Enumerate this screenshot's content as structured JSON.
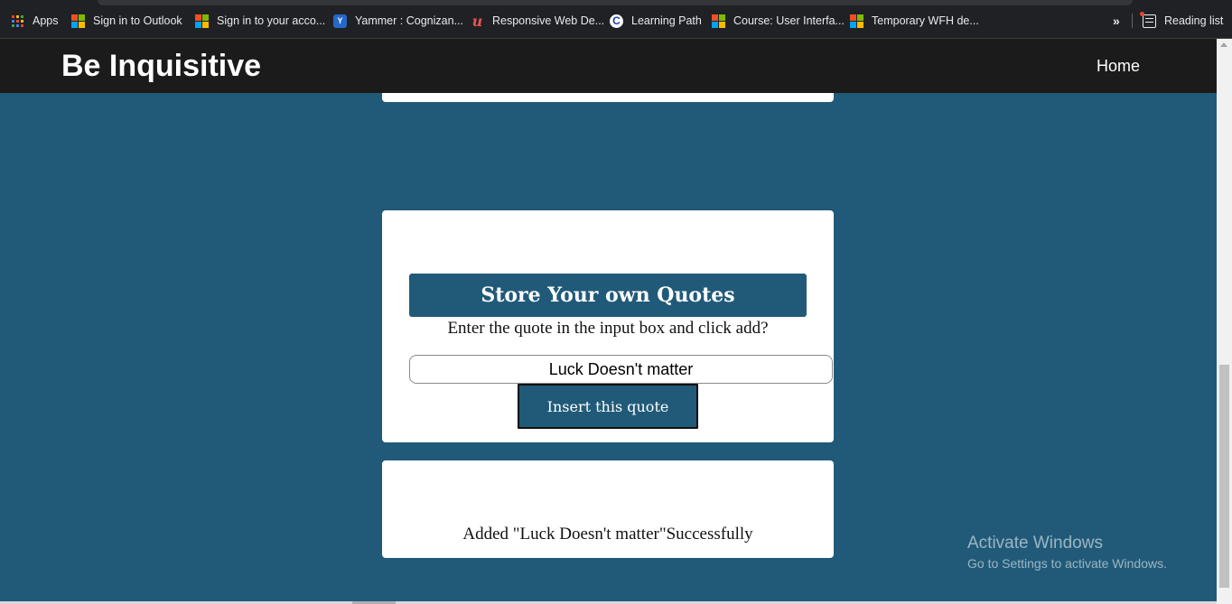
{
  "bookmarks": {
    "items": [
      {
        "label": "Apps",
        "icon": "apps-grid-icon"
      },
      {
        "label": "Sign in to Outlook",
        "icon": "microsoft-logo-icon"
      },
      {
        "label": "Sign in to your acco...",
        "icon": "microsoft-logo-icon"
      },
      {
        "label": "Yammer : Cognizan...",
        "icon": "yammer-icon"
      },
      {
        "label": "Responsive Web De...",
        "icon": "udemy-icon"
      },
      {
        "label": "Learning Path",
        "icon": "c-logo-icon"
      },
      {
        "label": "Course: User Interfa...",
        "icon": "microsoft-logo-icon"
      },
      {
        "label": "Temporary WFH de...",
        "icon": "microsoft-logo-icon"
      }
    ],
    "overflow": "»",
    "reading_list": "Reading list"
  },
  "navbar": {
    "brand": "Be Inquisitive",
    "home": "Home"
  },
  "store": {
    "title": "Store Your own Quotes",
    "prompt": "Enter the quote in the input box and click add?",
    "input_value": "Luck Doesn't matter",
    "button": "Insert this quote"
  },
  "result": {
    "message": "Added \"Luck Doesn't matter\"Successfully"
  },
  "watermark": {
    "line1": "Activate Windows",
    "line2": "Go to Settings to activate Windows."
  },
  "colors": {
    "page_bg": "#215a79",
    "navbar_bg": "#1b1b1b",
    "card_bg": "#ffffff",
    "accent": "#215a79"
  }
}
